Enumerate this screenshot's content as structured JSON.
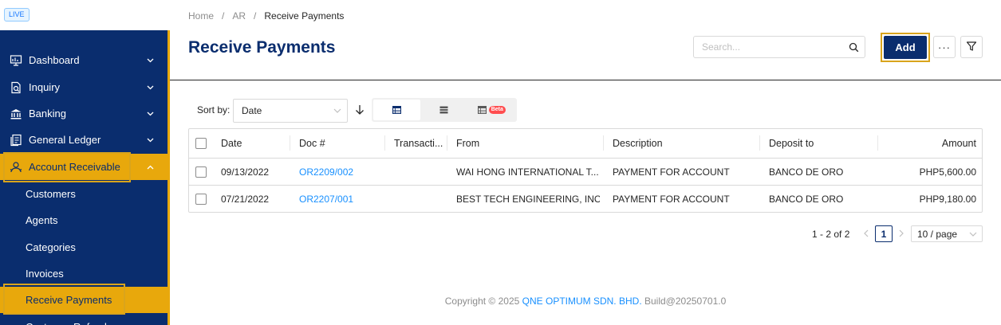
{
  "env_badge": "LIVE",
  "sidebar": {
    "items": [
      {
        "label": "Dashboard",
        "icon": "dashboard-icon"
      },
      {
        "label": "Inquiry",
        "icon": "inquiry-icon"
      },
      {
        "label": "Banking",
        "icon": "bank-icon"
      },
      {
        "label": "General Ledger",
        "icon": "ledger-icon"
      },
      {
        "label": "Account Receivable",
        "icon": "account-receivable-icon"
      }
    ],
    "sub_items": [
      "Customers",
      "Agents",
      "Categories",
      "Invoices",
      "Receive Payments",
      "Customer Refunds"
    ]
  },
  "breadcrumb": [
    "Home",
    "AR",
    "Receive Payments"
  ],
  "page": {
    "title": "Receive Payments"
  },
  "toolbar": {
    "search_placeholder": "Search...",
    "add_label": "Add",
    "more_label": "···"
  },
  "sort": {
    "label": "Sort by:",
    "value": "Date"
  },
  "view_options": {
    "beta_label": "Beta"
  },
  "table": {
    "columns": [
      "Date",
      "Doc #",
      "Transacti...",
      "From",
      "Description",
      "Deposit to",
      "Amount"
    ],
    "rows": [
      {
        "date": "09/13/2022",
        "doc": "OR2209/002",
        "transaction": "",
        "from": "WAI HONG INTERNATIONAL T...",
        "description": "PAYMENT FOR ACCOUNT",
        "deposit_to": "BANCO DE ORO",
        "amount": "PHP5,600.00"
      },
      {
        "date": "07/21/2022",
        "doc": "OR2207/001",
        "transaction": "",
        "from": "BEST TECH ENGINEERING, INC",
        "description": "PAYMENT FOR ACCOUNT",
        "deposit_to": "BANCO DE ORO",
        "amount": "PHP9,180.00"
      }
    ]
  },
  "pagination": {
    "total": "1 - 2 of 2",
    "current_page": "1",
    "page_size": "10 / page"
  },
  "footer": {
    "prefix": "Copyright © 2025",
    "company": "QNE OPTIMUM SDN. BHD.",
    "build": "Build@20250701.0"
  },
  "colors": {
    "navy": "#0a2d6e",
    "gold": "#e8a80c",
    "link": "#1890ff"
  }
}
